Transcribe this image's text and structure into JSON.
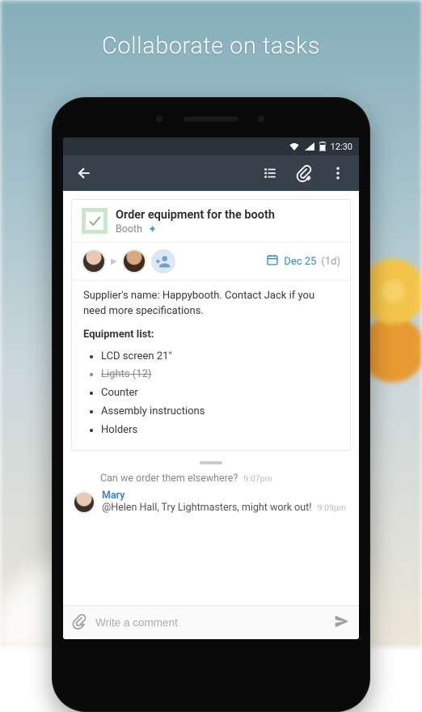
{
  "headline": "Collaborate on tasks",
  "statusbar": {
    "time": "12:30"
  },
  "task": {
    "title": "Order equipment for the booth",
    "folder": "Booth",
    "add_folder": "+"
  },
  "dates": {
    "icon": "calendar",
    "due": "Dec 25",
    "duration": "(1d)"
  },
  "description": "Supplier's name: Happybooth. Contact Jack if you need more specifications.",
  "equipment": {
    "title": "Equipment list:",
    "items": [
      {
        "text": "LCD screen 21\"",
        "done": false
      },
      {
        "text": "Lights (12)",
        "done": true
      },
      {
        "text": "Counter",
        "done": false
      },
      {
        "text": "Assembly instructions",
        "done": false
      },
      {
        "text": "Holders",
        "done": false
      }
    ]
  },
  "comments": {
    "trail": {
      "text": "Can we order them elsewhere?",
      "time": "9:07pm"
    },
    "last": {
      "author": "Mary",
      "text": "@Helen Hall, Try Lightmasters, might work out!",
      "time": "9:09pm"
    }
  },
  "composer": {
    "placeholder": "Write a comment"
  }
}
